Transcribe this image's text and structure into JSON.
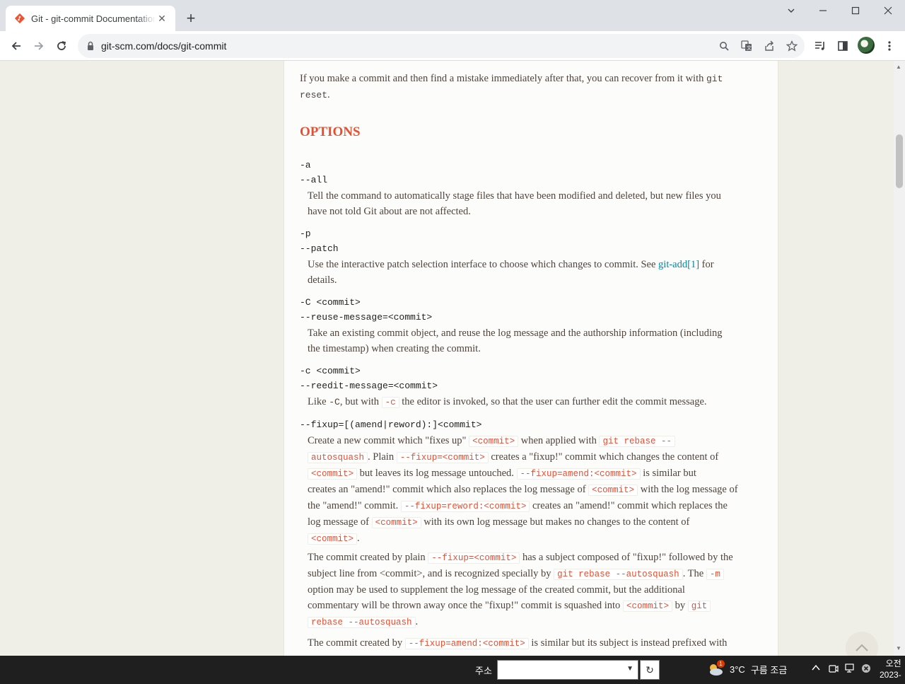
{
  "browser": {
    "tab_title": "Git - git-commit Documentation",
    "tab_close": "✕",
    "new_tab": "+",
    "url": "git-scm.com/docs/git-commit"
  },
  "doc": {
    "intro_line1_text": "If you make a commit and then find a mistake immediately after that, you can recover from it with ",
    "intro_line1_code": "git",
    "intro_line2_code": "reset",
    "intro_line2_end": ".",
    "heading": "OPTIONS",
    "opt_a": {
      "term1": "-a",
      "term2": "--all",
      "line1": "Tell the command to automatically stage files that have been modified and deleted, but new files you",
      "line2": "have not told Git about are not affected."
    },
    "opt_p": {
      "term1": "-p",
      "term2": "--patch",
      "line1_pre": "Use the interactive patch selection interface to choose which changes to commit. See ",
      "line1_link": "git-add[1]",
      "line1_post": " for",
      "line2": "details."
    },
    "opt_C": {
      "term1": "-C <commit>",
      "term2": "--reuse-message=<commit>",
      "line1": "Take an existing commit object, and reuse the log message and the authorship information (including",
      "line2": "the timestamp) when creating the commit."
    },
    "opt_c": {
      "term1": "-c <commit>",
      "term2": "--reedit-message=<commit>",
      "pre": "Like ",
      "code1": "-C",
      "mid": ", but with ",
      "code2": "-c",
      "post": " the editor is invoked, so that the user can further edit the commit message."
    },
    "opt_fixup": {
      "term": "--fixup=[(amend|reword):]<commit>",
      "p1": {
        "l1a": "Create a new commit which \"fixes up\" ",
        "l1c1": "<commit>",
        "l1b": " when applied with ",
        "l1c2": "git rebase --",
        "l2c1": "autosquash",
        "l2a": ". Plain ",
        "l2c2": "--fixup=<commit>",
        "l2b": " creates a \"fixup!\" commit which changes the content of",
        "l3c1": "<commit>",
        "l3a": " but leaves its log message untouched. ",
        "l3c2": "--fixup=amend:<commit>",
        "l3b": " is similar but",
        "l4a": "creates an \"amend!\" commit which also replaces the log message of ",
        "l4c1": "<commit>",
        "l4b": " with the log message of",
        "l5a": "the \"amend!\" commit. ",
        "l5c1": "--fixup=reword:<commit>",
        "l5b": " creates an \"amend!\" commit which replaces the",
        "l6a": "log message of ",
        "l6c1": "<commit>",
        "l6b": " with its own log message but makes no changes to the content of",
        "l7c1": "<commit>",
        "l7a": "."
      },
      "p2": {
        "l1a": "The commit created by plain ",
        "l1c1": "--fixup=<commit>",
        "l1b": " has a subject composed of \"fixup!\" followed by the",
        "l2a": "subject line from <commit>, and is recognized specially by ",
        "l2c1": "git rebase --autosquash",
        "l2b": ". The ",
        "l2c2": "-m",
        "l3a": "option may be used to supplement the log message of the created commit, but the additional",
        "l4a": "commentary will be thrown away once the \"fixup!\" commit is squashed into ",
        "l4c1": "<commit>",
        "l4b": " by ",
        "l4c2": "git",
        "l5c1": "rebase --autosquash",
        "l5a": "."
      },
      "p3": {
        "l1a": "The commit created by ",
        "l1c1": "--fixup=amend:<commit>",
        "l1b": " is similar but its subject is instead prefixed with"
      }
    }
  },
  "taskbar": {
    "address_label": "주소",
    "go_button": "↻",
    "weather_temp": "3°C",
    "weather_desc": "구름 조금",
    "weather_badge": "1",
    "clock_line1": "오전",
    "clock_line2": "2023-"
  },
  "colors": {
    "accent": "#e94e31",
    "link": "#0388a6",
    "text": "#4e443c"
  }
}
